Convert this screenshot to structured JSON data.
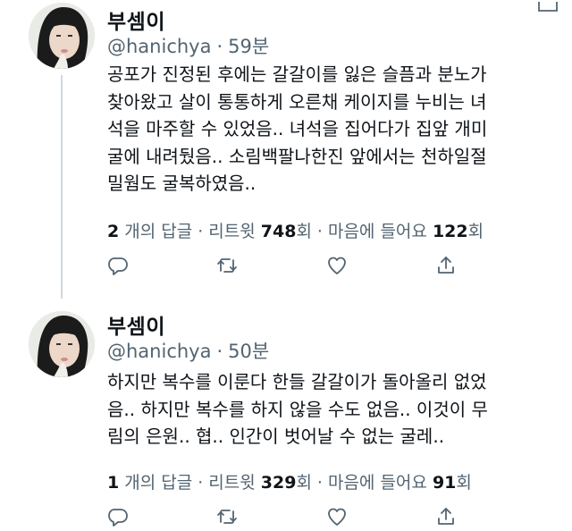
{
  "tweets": [
    {
      "display_name": "부셈이",
      "handle": "@hanichya",
      "separator": "·",
      "time": "59분",
      "text": "공포가 진정된 후에는 갈갈이를 잃은 슬픔과 분노가\n찾아왔고 살이 통통하게 오른채 케이지를 누비는 녀\n석을 마주할 수 있었음.. 녀석을 집어다가 집앞 개미\n굴에 내려뒀음.. 소림백팔나한진 앞에서는 천하일절\n밀웜도 굴복하였음..",
      "replies_count": "2",
      "replies_label": " 개의 답글",
      "retweets_label": "리트윗 ",
      "retweets_count": "748",
      "retweets_unit": "회",
      "likes_label": "마음에 들어요 ",
      "likes_count": "122",
      "likes_unit": "회"
    },
    {
      "display_name": "부셈이",
      "handle": "@hanichya",
      "separator": "·",
      "time": "50분",
      "text": "하지만 복수를 이룬다 한들 갈갈이가 돌아올리 없었\n음.. 하지만 복수를 하지 않을 수도 없음.. 이것이 무\n림의 은원.. 협.. 인간이 벗어날 수 없는 굴레..",
      "replies_count": "1",
      "replies_label": " 개의 답글",
      "retweets_label": "리트윗 ",
      "retweets_count": "329",
      "retweets_unit": "회",
      "likes_label": "마음에 들어요 ",
      "likes_count": "91",
      "likes_unit": "회"
    }
  ],
  "stats_separator": "·",
  "icons": [
    "reply-icon",
    "retweet-icon",
    "like-icon",
    "share-icon",
    "more-icon"
  ],
  "colors": {
    "secondary_text": "#536471",
    "primary_text": "#0f1419",
    "thread_line": "#cfd9de"
  }
}
